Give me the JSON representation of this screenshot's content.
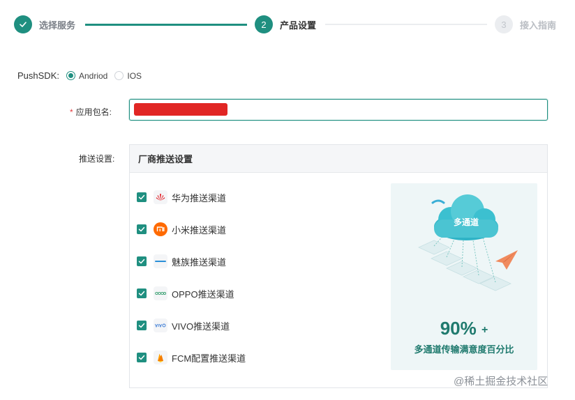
{
  "stepper": {
    "steps": [
      {
        "number": "",
        "label": "选择服务",
        "state": "done"
      },
      {
        "number": "2",
        "label": "产品设置",
        "state": "active"
      },
      {
        "number": "3",
        "label": "接入指南",
        "state": "todo"
      }
    ]
  },
  "form": {
    "push_sdk": {
      "label": "PushSDK:",
      "options": [
        {
          "label": "Andriod",
          "checked": true
        },
        {
          "label": "IOS",
          "checked": false
        }
      ]
    },
    "package_name": {
      "required_mark": "*",
      "label": "应用包名:",
      "value": ""
    },
    "push_settings": {
      "label": "推送设置:",
      "panel_title": "厂商推送设置",
      "channels": [
        {
          "label": "华为推送渠道",
          "checked": true,
          "icon": "huawei-logo-icon"
        },
        {
          "label": "小米推送渠道",
          "checked": true,
          "icon": "xiaomi-logo-icon"
        },
        {
          "label": "魅族推送渠道",
          "checked": true,
          "icon": "meizu-logo-icon"
        },
        {
          "label": "OPPO推送渠道",
          "checked": true,
          "icon": "oppo-logo-icon"
        },
        {
          "label": "VIVO推送渠道",
          "checked": true,
          "icon": "vivo-logo-icon"
        },
        {
          "label": "FCM配置推送渠道",
          "checked": true,
          "icon": "fcm-logo-icon"
        }
      ],
      "promo": {
        "cloud_text": "多通道",
        "percent": "90%",
        "plus": "+",
        "subtitle": "多通道传输满意度百分比"
      }
    }
  },
  "watermark": "@稀土掘金技术社区",
  "colors": {
    "accent": "#1f8f80",
    "required": "#e4393c",
    "redaction": "#e12624"
  }
}
